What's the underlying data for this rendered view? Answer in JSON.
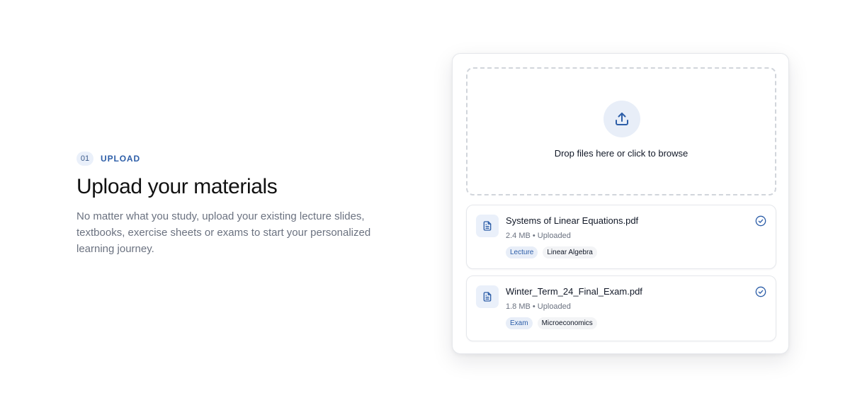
{
  "section": {
    "step_number": "01",
    "step_label": "UPLOAD",
    "title": "Upload your materials",
    "description": "No matter what you study, upload your existing lecture slides, textbooks, exercise sheets or exams to start your personalized learning journey."
  },
  "dropzone": {
    "text": "Drop files here or click to browse",
    "icon": "upload-icon"
  },
  "files": [
    {
      "name": "Systems of Linear Equations.pdf",
      "meta": "2.4 MB • Uploaded",
      "tags": [
        "Lecture",
        "Linear Algebra"
      ],
      "icon": "file-text-icon",
      "status_icon": "check-circle-icon"
    },
    {
      "name": "Winter_Term_24_Final_Exam.pdf",
      "meta": "1.8 MB • Uploaded",
      "tags": [
        "Exam",
        "Microeconomics"
      ],
      "icon": "file-text-icon",
      "status_icon": "check-circle-icon"
    }
  ],
  "colors": {
    "accent": "#2d5ea8",
    "accent_soft": "#e8eef8",
    "muted_text": "#6b7280",
    "border": "#e5e7eb"
  }
}
